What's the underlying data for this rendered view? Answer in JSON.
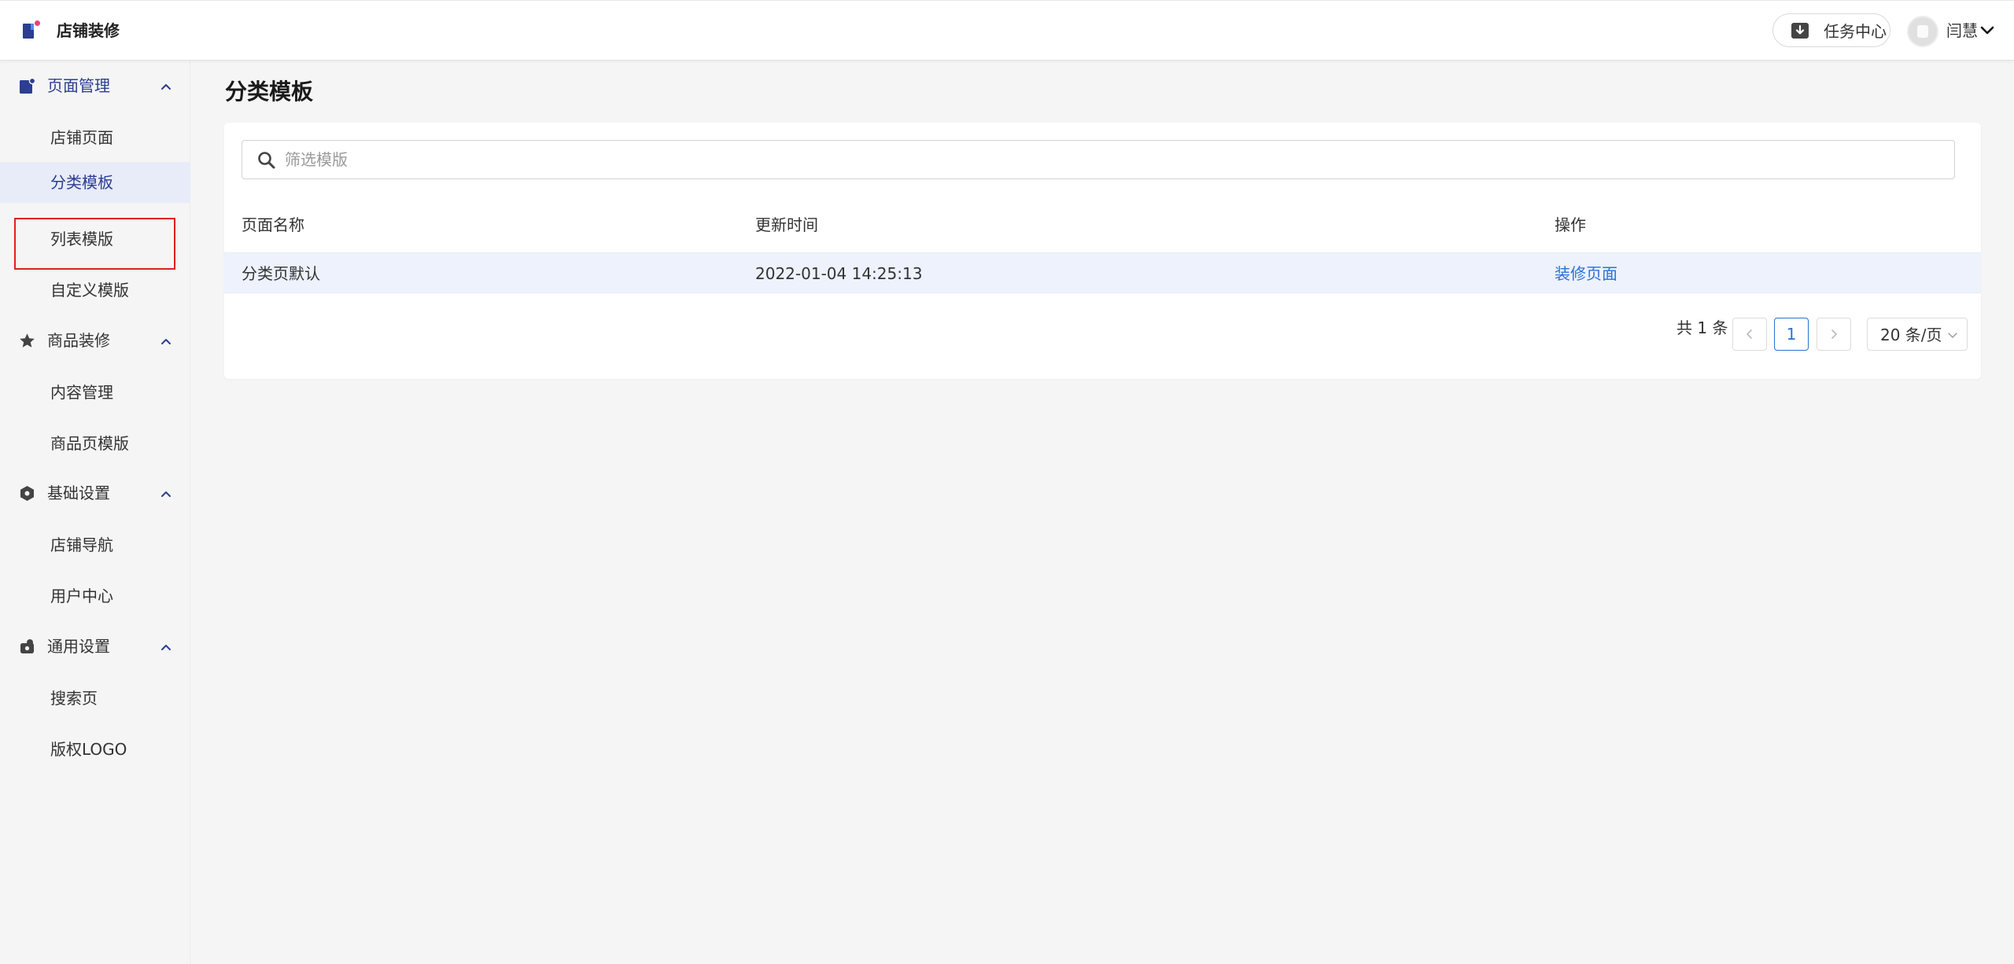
{
  "app": {
    "title": "店铺装修"
  },
  "header": {
    "task_center": "任务中心",
    "username": "闫慧"
  },
  "sidebar": {
    "groups": [
      {
        "label": "页面管理",
        "icon": "page-icon",
        "items": [
          {
            "label": "店铺页面"
          },
          {
            "label": "分类模板",
            "active": true
          },
          {
            "label": "列表模版"
          },
          {
            "label": "自定义模版"
          }
        ]
      },
      {
        "label": "商品装修",
        "icon": "star-icon",
        "items": [
          {
            "label": "内容管理"
          },
          {
            "label": "商品页模版"
          }
        ]
      },
      {
        "label": "基础设置",
        "icon": "hexagon-icon",
        "items": [
          {
            "label": "店铺导航"
          },
          {
            "label": "用户中心"
          }
        ]
      },
      {
        "label": "通用设置",
        "icon": "settings-icon",
        "items": [
          {
            "label": "搜索页"
          },
          {
            "label": "版权LOGO"
          }
        ]
      }
    ]
  },
  "main": {
    "title": "分类模板",
    "search": {
      "placeholder": "筛选模版",
      "value": ""
    },
    "table": {
      "columns": [
        "页面名称",
        "更新时间",
        "操作"
      ],
      "rows": [
        {
          "name": "分类页默认",
          "updated": "2022-01-04 14:25:13",
          "action": "装修页面"
        }
      ]
    },
    "pagination": {
      "total": "共 1 条",
      "current_page": "1",
      "page_size": "20 条/页"
    }
  },
  "colors": {
    "accent": "#2c3e91",
    "link": "#2a72d4",
    "highlight_box": "#e02020",
    "row_bg": "#edf2fc"
  }
}
